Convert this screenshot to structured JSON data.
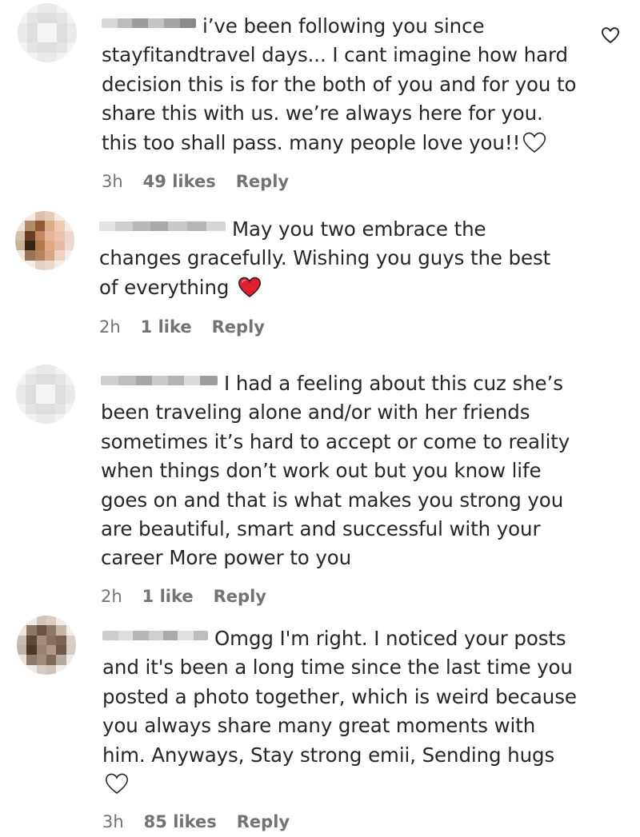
{
  "comments": [
    {
      "text": "i’ve been following you since stayfitandtravel days... I cant imagine how hard decision this is for the both of you and for you to share this with us. we’re always here for you. this too shall pass. many people love you!!",
      "emoji": "white-heart",
      "time": "3h",
      "likes": "49 likes",
      "reply": "Reply"
    },
    {
      "text": "May you two embrace the changes gracefully. Wishing you guys the best of everything",
      "emoji": "red-heart",
      "time": "2h",
      "likes": "1 like",
      "reply": "Reply"
    },
    {
      "text": "I had a feeling about this cuz she’s been traveling alone and/or with her friends sometimes it’s hard to accept or come to reality when things don’t work out but you know life goes on and that is what makes you strong you are beautiful, smart and successful with your career More power to you",
      "emoji": "",
      "time": "2h",
      "likes": "1 like",
      "reply": "Reply"
    },
    {
      "text": "Omgg I'm right. I noticed your posts and it's been a long time since the last time you posted a photo together, which is weird because you always share many great moments with him. Anyways, Stay strong emii, Sending hugs",
      "emoji": "white-heart",
      "time": "3h",
      "likes": "85 likes",
      "reply": "Reply"
    }
  ],
  "icons": {
    "like": "heart-outline-icon"
  },
  "colors": {
    "text": "#262626",
    "meta": "#737373",
    "red_heart": "#e0202e"
  }
}
